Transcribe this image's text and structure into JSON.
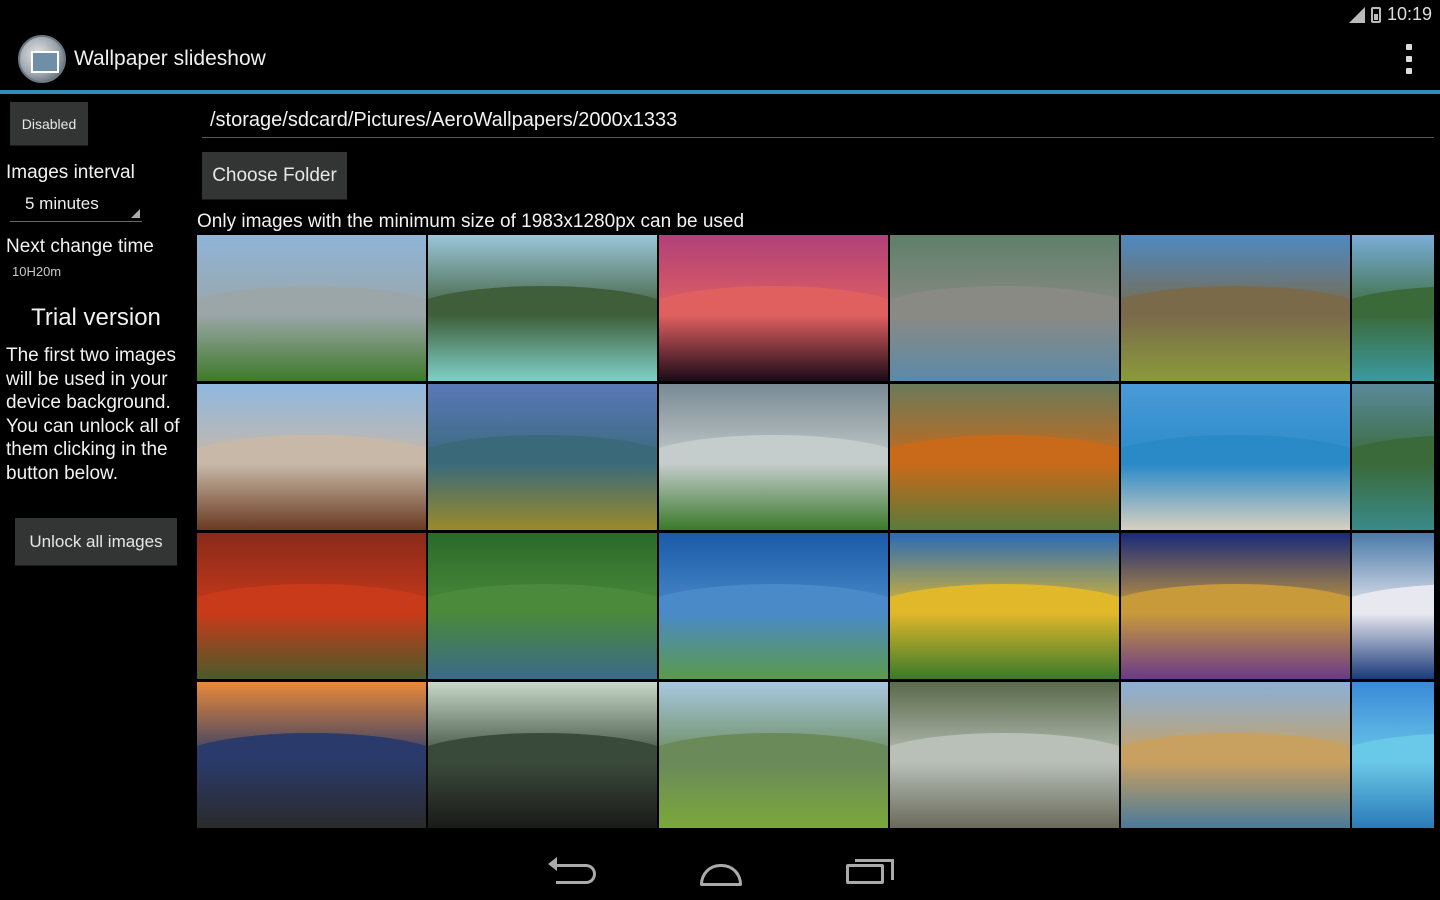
{
  "status_bar": {
    "time": "10:19",
    "icons": [
      "signal-icon",
      "battery-icon"
    ]
  },
  "action_bar": {
    "title": "Wallpaper slideshow",
    "app_icon": "app-icon",
    "overflow_icon": "overflow-menu-icon"
  },
  "sidebar": {
    "toggle_button": "Disabled",
    "interval_label": "Images interval",
    "interval_value": "5 minutes",
    "next_change_label": "Next change time",
    "next_change_value": "10H20m",
    "trial_title": "Trial version",
    "trial_text": "The first two images will be used in your device background. You can unlock all of them clicking in the button below.",
    "unlock_button": "Unlock all images"
  },
  "main": {
    "folder_path": "/storage/sdcard/Pictures/AeroWallpapers/2000x1333",
    "choose_folder_button": "Choose Folder",
    "min_size_note": "Only images with the minimum size of 1983x1280px can be used"
  },
  "thumbnails": [
    {
      "sky": "#8fb4d8",
      "mid": "#9aa6a8",
      "ground": "#3f7a2a"
    },
    {
      "sky": "#9cc6da",
      "mid": "#3f5f3a",
      "ground": "#7fd0c8"
    },
    {
      "sky": "#b0407a",
      "mid": "#e06060",
      "ground": "#1a0a18"
    },
    {
      "sky": "#5f7f6a",
      "mid": "#8a8a84",
      "ground": "#5c8aa8"
    },
    {
      "sky": "#4e8ac2",
      "mid": "#7a6a4a",
      "ground": "#8a9a3a"
    },
    {
      "sky": "#7aaed8",
      "mid": "#3a6a3a",
      "ground": "#3c9aa0"
    },
    {
      "sky": "#8fb8e0",
      "mid": "#c8b8a8",
      "ground": "#6a3a22"
    },
    {
      "sky": "#5a78b8",
      "mid": "#3a6a7a",
      "ground": "#9a8a2a"
    },
    {
      "sky": "#7a8a94",
      "mid": "#c4cccc",
      "ground": "#3a7a2a"
    },
    {
      "sky": "#6a7a5a",
      "mid": "#c86a1a",
      "ground": "#5a7a3a"
    },
    {
      "sky": "#4a9ad8",
      "mid": "#2a8ac8",
      "ground": "#d8d0c0"
    },
    {
      "sky": "#5a8a9a",
      "mid": "#3a6a3a",
      "ground": "#3a8a8a"
    },
    {
      "sky": "#8a2a1a",
      "mid": "#c83a1a",
      "ground": "#4a5a2a"
    },
    {
      "sky": "#2a6a2a",
      "mid": "#4a8a3a",
      "ground": "#3a6a8a"
    },
    {
      "sky": "#1a5aa8",
      "mid": "#4a8ac8",
      "ground": "#5a9a4a"
    },
    {
      "sky": "#2a6ab8",
      "mid": "#e0b82a",
      "ground": "#3a7a2a"
    },
    {
      "sky": "#1a2a7a",
      "mid": "#c89a3a",
      "ground": "#6a3a8a"
    },
    {
      "sky": "#4a7aa8",
      "mid": "#e8e8f0",
      "ground": "#1a3a7a"
    },
    {
      "sky": "#e88a3a",
      "mid": "#2a3a6a",
      "ground": "#2a2a2a"
    },
    {
      "sky": "#c8d8c8",
      "mid": "#3a4a3a",
      "ground": "#1a1a1a"
    },
    {
      "sky": "#a8c8e0",
      "mid": "#6a8a5a",
      "ground": "#7aa83a"
    },
    {
      "sky": "#5a6a4a",
      "mid": "#b8c0b8",
      "ground": "#6a6a5a"
    },
    {
      "sky": "#8ab0d8",
      "mid": "#c8a060",
      "ground": "#4a7a9a"
    },
    {
      "sky": "#3a8ad8",
      "mid": "#6ac8e8",
      "ground": "#2a7ab8"
    }
  ]
}
